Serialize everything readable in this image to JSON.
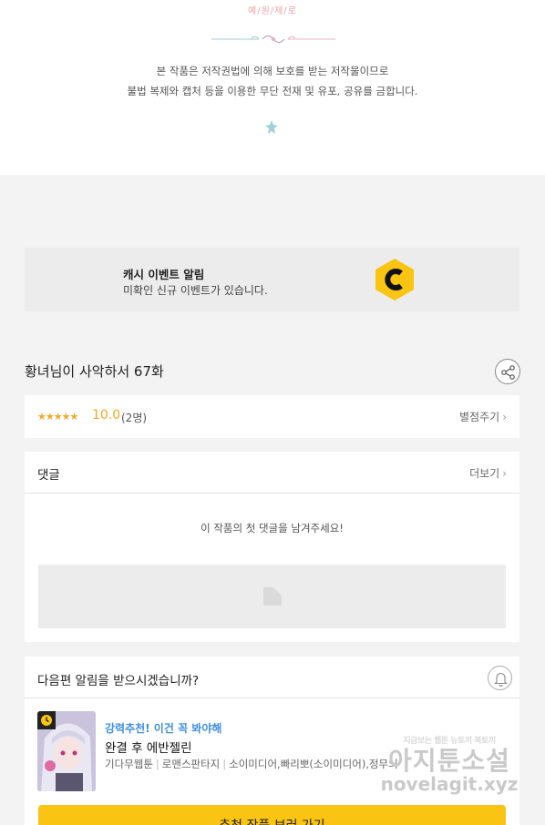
{
  "copyright": {
    "studio": "예/원/제/로",
    "line1": "본 작품은 저작권법에 의해 보호를 받는 저작물이므로",
    "line2": "불법 복제와 캡처 등을 이용한 무단 전재 및 유포, 공유를 금합니다."
  },
  "cash_event": {
    "title": "캐시 이벤트 알림",
    "subtitle": "미확인 신규 이벤트가 있습니다.",
    "logo_letter": "C",
    "logo_color": "#f9c412"
  },
  "episode": {
    "title": "황녀님이 사악하서 67화"
  },
  "rating": {
    "stars": "★★★★★",
    "score": "10.0",
    "count": "(2명)",
    "rate_label": "별점주기",
    "accent": "#f5a623"
  },
  "comments": {
    "title": "댓글",
    "more_label": "더보기",
    "empty_text": "이 작품의 첫 댓글을 남겨주세요!"
  },
  "next_alert": {
    "question": "다음편 알림을 받으시겠습니까?",
    "bell_icon": "bell-icon"
  },
  "recommend": {
    "label": "강력추천! 이건 꼭 봐야해",
    "title": "완결 후 에반젤린",
    "meta": [
      "기다무웹툰",
      "로맨스판타지",
      "소이미디어,빠리뽀(소이미디어),정무늬"
    ],
    "button_label": "추천 작품 보러 가기",
    "label_color": "#3d8fe0",
    "button_color": "#f9c412"
  },
  "watermark": {
    "tagline": "지금보는 웹툰 뉴토끼 북토끼",
    "brand": "아지툰소설",
    "url": "novelagit.xyz"
  }
}
